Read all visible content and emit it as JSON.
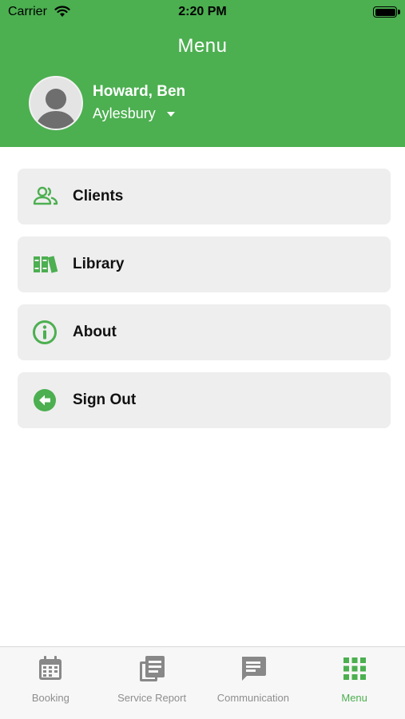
{
  "status_bar": {
    "carrier": "Carrier",
    "time": "2:20 PM"
  },
  "header": {
    "title": "Menu",
    "user_name": "Howard, Ben",
    "location": "Aylesbury",
    "background_color": "#4caf50"
  },
  "menu": {
    "items": [
      {
        "label": "Clients",
        "icon": "clients-icon"
      },
      {
        "label": "Library",
        "icon": "library-icon"
      },
      {
        "label": "About",
        "icon": "info-icon"
      },
      {
        "label": "Sign Out",
        "icon": "sign-out-icon"
      }
    ]
  },
  "tab_bar": {
    "tabs": [
      {
        "label": "Booking",
        "icon": "calendar-icon",
        "active": false
      },
      {
        "label": "Service Report",
        "icon": "report-icon",
        "active": false
      },
      {
        "label": "Communication",
        "icon": "chat-icon",
        "active": false
      },
      {
        "label": "Menu",
        "icon": "grid-icon",
        "active": true
      }
    ],
    "active_color": "#4caf50",
    "inactive_color": "#8e8e8e"
  }
}
